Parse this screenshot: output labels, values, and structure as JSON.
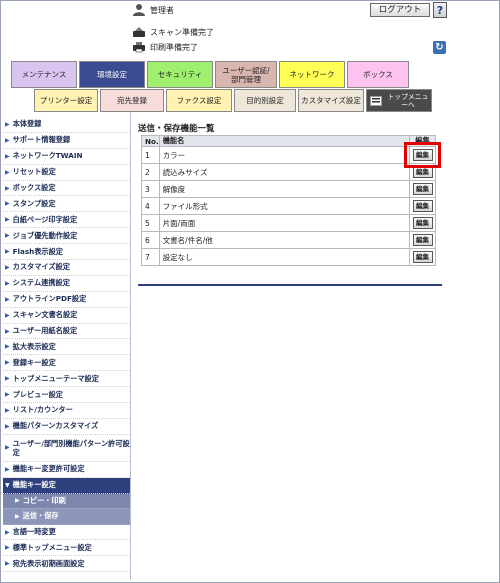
{
  "header": {
    "user_label": "管理者",
    "status_scan": "スキャン準備完了",
    "status_print": "印刷準備完了",
    "logout_label": "ログアウト",
    "help_label": "?",
    "refresh_label": "↻"
  },
  "colors": {
    "sidebar_selected": "#2e3f7e",
    "highlight": "#e00000"
  },
  "tabs": [
    {
      "label": "メンテナンス",
      "color": "#d8c4ee",
      "text": "#222"
    },
    {
      "label": "環境設定",
      "color": "#3b4b8f",
      "text": "#ffffff"
    },
    {
      "label": "セキュリティ",
      "color": "#9ff06f",
      "text": "#222"
    },
    {
      "label": "ユーザー認証/部門管理",
      "color": "#d9b6ae",
      "text": "#222"
    },
    {
      "label": "ネットワーク",
      "color": "#ffff55",
      "text": "#222"
    },
    {
      "label": "ボックス",
      "color": "#ffc3ef",
      "text": "#222"
    }
  ],
  "subtabs": [
    {
      "label": "プリンター設定",
      "color": "#fff2b2"
    },
    {
      "label": "宛先登録",
      "color": "#f8dcdc"
    },
    {
      "label": "ファクス設定",
      "color": "#fff2b2"
    },
    {
      "label": "目的別設定",
      "color": "#efe6da"
    },
    {
      "label": "カスタマイズ設定",
      "color": "#efe6da"
    },
    {
      "label": "トップメニューへ",
      "color": "#4a4a4a"
    }
  ],
  "sidebar": {
    "items": [
      "本体登録",
      "サポート情報登録",
      "ネットワークTWAIN",
      "リセット設定",
      "ボックス設定",
      "スタンプ設定",
      "白紙ページ印字設定",
      "ジョブ優先動作設定",
      "Flash表示設定",
      "カスタマイズ設定",
      "システム連携設定",
      "アウトラインPDF設定",
      "スキャン文書名設定",
      "ユーザー用紙名設定",
      "拡大表示設定",
      "登録キー設定",
      "トップメニューテーマ設定",
      "プレビュー設定",
      "リスト/カウンター",
      "機能パターンカスタマイズ",
      "ユーザー/部門別機能パターン許可設定",
      "機能キー変更許可設定"
    ],
    "selected": "機能キー設定",
    "subitems": [
      "コピー・印刷",
      "送信・保存"
    ],
    "items_after": [
      "言語一時変更",
      "標準トップメニュー設定",
      "宛先表示初期画面設定"
    ]
  },
  "main": {
    "title": "送信・保存機能一覧",
    "columns": [
      "No.",
      "機能名",
      "編集"
    ],
    "rows": [
      {
        "no": "1",
        "name": "カラー"
      },
      {
        "no": "2",
        "name": "読込みサイズ"
      },
      {
        "no": "3",
        "name": "解像度"
      },
      {
        "no": "4",
        "name": "ファイル形式"
      },
      {
        "no": "5",
        "name": "片面/両面"
      },
      {
        "no": "6",
        "name": "文書名/件名/他"
      },
      {
        "no": "7",
        "name": "設定なし"
      }
    ],
    "edit_label": "編集"
  }
}
